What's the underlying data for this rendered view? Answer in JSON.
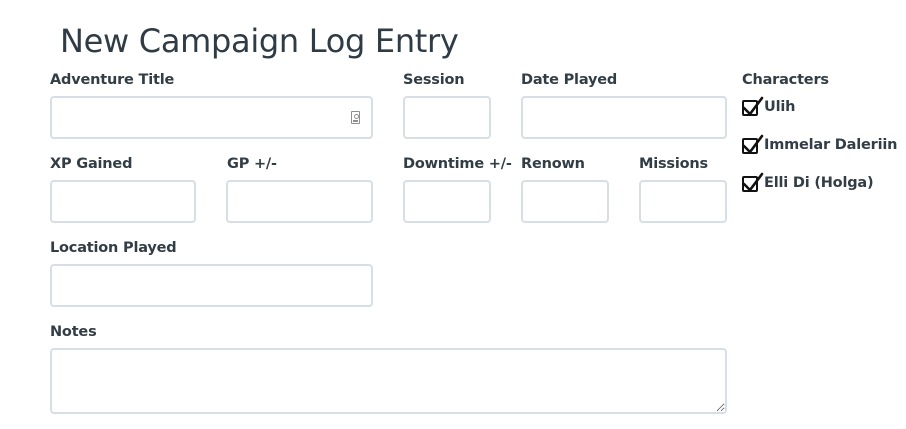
{
  "page": {
    "title": "New Campaign Log Entry"
  },
  "fields": {
    "adventure_title": {
      "label": "Adventure Title",
      "value": ""
    },
    "session": {
      "label": "Session",
      "value": ""
    },
    "date_played": {
      "label": "Date Played",
      "value": ""
    },
    "xp_gained": {
      "label": "XP Gained",
      "value": ""
    },
    "gp": {
      "label": "GP +/-",
      "value": ""
    },
    "downtime": {
      "label": "Downtime +/-",
      "value": ""
    },
    "renown": {
      "label": "Renown",
      "value": ""
    },
    "missions": {
      "label": "Missions",
      "value": ""
    },
    "location_played": {
      "label": "Location Played",
      "value": ""
    },
    "notes": {
      "label": "Notes",
      "value": ""
    }
  },
  "characters": {
    "label": "Characters",
    "items": [
      {
        "name": "Ulih",
        "checked": true
      },
      {
        "name": "Immelar Daleriin",
        "checked": true
      },
      {
        "name": "Elli Di (Holga)",
        "checked": true
      }
    ]
  },
  "icons": {
    "title_field_icon": "contact-card-icon",
    "checkbox_mark": "checkmark-icon"
  },
  "colors": {
    "border": "#d7dfe6",
    "text": "#333d46",
    "title": "#2f3b45"
  }
}
